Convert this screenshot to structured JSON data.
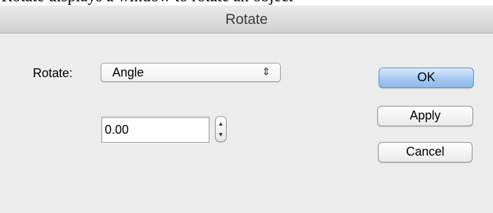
{
  "caption": "Rotate displays a window to rotate an object",
  "dialog": {
    "title": "Rotate"
  },
  "form": {
    "rotate_label": "Rotate:",
    "rotate_mode": {
      "selected": "Angle"
    },
    "angle": {
      "value": "0.00"
    }
  },
  "buttons": {
    "ok": "OK",
    "apply": "Apply",
    "cancel": "Cancel"
  },
  "colors": {
    "default_button": "#a6c8f0",
    "window_background": "#ececec"
  },
  "icons": {
    "select_arrows": "up-down-chevrons-icon",
    "stepper": "up-down-stepper-icon"
  }
}
